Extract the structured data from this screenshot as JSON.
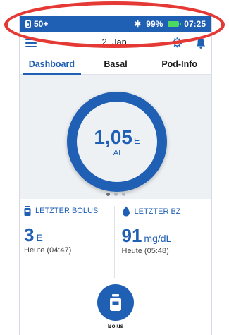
{
  "status_bar": {
    "pod_reservoir": "50+",
    "battery_percent": "99%",
    "time": "07:25",
    "bluetooth_icon": "bluetooth-icon",
    "battery_color": "#4cd964"
  },
  "header": {
    "date": "2. Jan.",
    "menu_icon": "menu-icon",
    "settings_icon": "gear-icon",
    "notifications_icon": "bell-icon"
  },
  "tabs": [
    {
      "label": "Dashboard",
      "active": true
    },
    {
      "label": "Basal",
      "active": false
    },
    {
      "label": "Pod-Info",
      "active": false
    }
  ],
  "gauge": {
    "value": "1,05",
    "unit": "E",
    "label": "AI"
  },
  "carousel": {
    "count": 3,
    "active_index": 0
  },
  "summary": {
    "last_bolus": {
      "title": "LETZTER BOLUS",
      "value": "3",
      "unit": "E",
      "time": "Heute (04:47)"
    },
    "last_bg": {
      "title": "LETZTER BZ",
      "value": "91",
      "unit": "mg/dL",
      "time": "Heute (05:48)"
    }
  },
  "bolus_button": {
    "label": "Bolus"
  },
  "colors": {
    "accent": "#1f5fb4",
    "highlight": "#e53935",
    "background": "#eef1f4"
  }
}
